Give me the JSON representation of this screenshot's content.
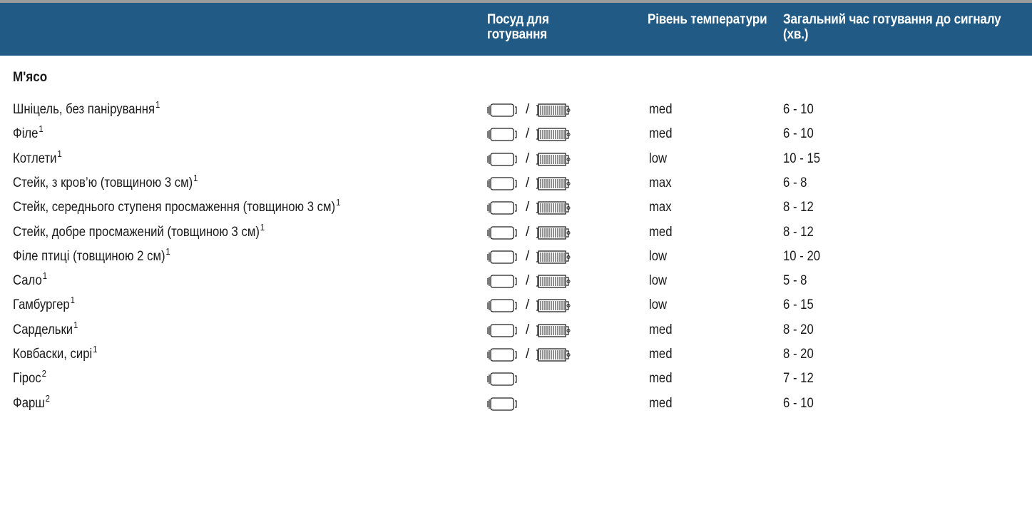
{
  "header": {
    "col1": "",
    "col2": "Посуд для готування",
    "col3": "Рівень температури",
    "col4": "Загальний час готування до сигналу (хв.)"
  },
  "section_title": "М'ясо",
  "icons": {
    "pan": "pan-icon",
    "grill": "grill-rack-icon",
    "separator": "/"
  },
  "rows": [
    {
      "dish": "Шніцель, без панірування",
      "note": "1",
      "vessels": [
        "pan",
        "grill"
      ],
      "temp": "med",
      "time": "6 - 10"
    },
    {
      "dish": "Філе",
      "note": "1",
      "vessels": [
        "pan",
        "grill"
      ],
      "temp": "med",
      "time": "6 - 10"
    },
    {
      "dish": "Котлети",
      "note": "1",
      "vessels": [
        "pan",
        "grill"
      ],
      "temp": "low",
      "time": "10 - 15"
    },
    {
      "dish": "Стейк, з кров’ю (товщиною 3 см)",
      "note": "1",
      "vessels": [
        "pan",
        "grill"
      ],
      "temp": "max",
      "time": "6 - 8"
    },
    {
      "dish": "Стейк, середнього ступеня просмаження (товщиною 3 см)",
      "note": "1",
      "vessels": [
        "pan",
        "grill"
      ],
      "temp": "max",
      "time": "8 - 12"
    },
    {
      "dish": "Стейк, добре просмажений (товщиною 3 см)",
      "note": "1",
      "vessels": [
        "pan",
        "grill"
      ],
      "temp": "med",
      "time": "8 - 12"
    },
    {
      "dish": "Філе птиці (товщиною 2 см)",
      "note": "1",
      "vessels": [
        "pan",
        "grill"
      ],
      "temp": "low",
      "time": "10 - 20"
    },
    {
      "dish": "Сало",
      "note": "1",
      "vessels": [
        "pan",
        "grill"
      ],
      "temp": "low",
      "time": "5 - 8"
    },
    {
      "dish": "Гамбургер",
      "note": "1",
      "vessels": [
        "pan",
        "grill"
      ],
      "temp": "low",
      "time": "6 - 15"
    },
    {
      "dish": "Сардельки",
      "note": "1",
      "vessels": [
        "pan",
        "grill"
      ],
      "temp": "med",
      "time": "8 - 20"
    },
    {
      "dish": "Ковбаски, сирі",
      "note": "1",
      "vessels": [
        "pan",
        "grill"
      ],
      "temp": "med",
      "time": "8 - 20"
    },
    {
      "dish": "Гірос",
      "note": "2",
      "vessels": [
        "pan"
      ],
      "temp": "med",
      "time": "7 - 12"
    },
    {
      "dish": "Фарш",
      "note": "2",
      "vessels": [
        "pan"
      ],
      "temp": "med",
      "time": "6 - 10"
    }
  ]
}
